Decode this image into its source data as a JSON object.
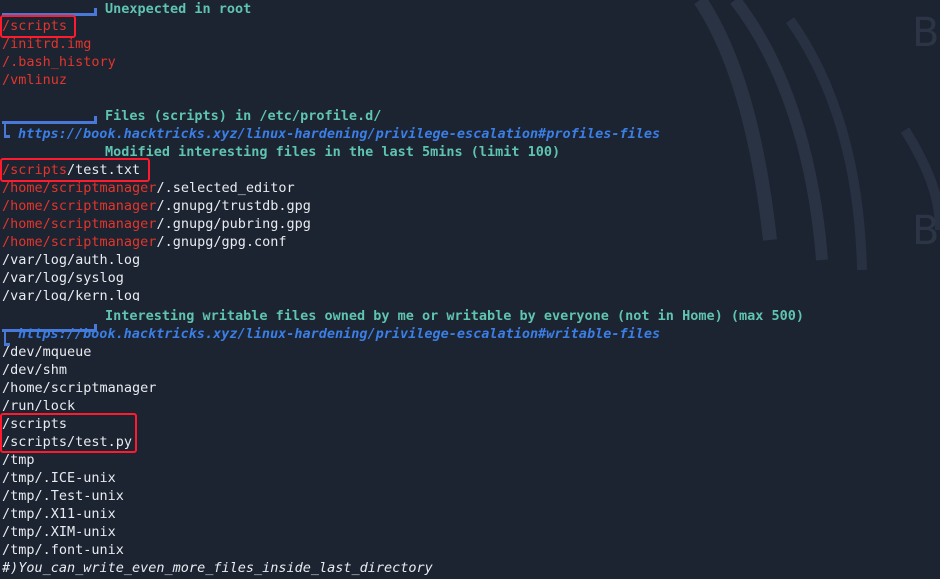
{
  "watermark": {
    "letter": "B"
  },
  "sections": {
    "unexpected_in_root": {
      "title": "Unexpected in root",
      "items": [
        "/scripts",
        "/initrd.img",
        "/.bash_history",
        "/vmlinuz"
      ]
    },
    "profile_files": {
      "title": "Files (scripts) in /etc/profile.d/",
      "link": "https://book.hacktricks.xyz/linux-hardening/privilege-escalation#profiles-files"
    },
    "modified_files": {
      "title": "Modified interesting files in the last 5mins (limit 100)",
      "items": [
        {
          "red": "/scripts",
          "white": "/test.txt"
        },
        {
          "red": "/home/scriptmanager",
          "white": "/.selected_editor"
        },
        {
          "red": "/home/scriptmanager",
          "white": "/.gnupg/trustdb.gpg"
        },
        {
          "red": "/home/scriptmanager",
          "white": "/.gnupg/pubring.gpg"
        },
        {
          "red": "/home/scriptmanager",
          "white": "/.gnupg/gpg.conf"
        },
        {
          "red": "",
          "white": "/var/log/auth.log"
        },
        {
          "red": "",
          "white": "/var/log/syslog"
        },
        {
          "red": "",
          "white": "/var/log/kern.log"
        }
      ]
    },
    "writable_files": {
      "title": "Interesting writable files owned by me or writable by everyone (not in Home) (max 500)",
      "link": "https://book.hacktricks.xyz/linux-hardening/privilege-escalation#writable-files",
      "items": [
        "/dev/mqueue",
        "/dev/shm",
        "/home/scriptmanager",
        "/run/lock",
        "/scripts",
        "/scripts/test.py",
        "/tmp",
        "/tmp/.ICE-unix",
        "/tmp/.Test-unix",
        "/tmp/.X11-unix",
        "/tmp/.XIM-unix",
        "/tmp/.font-unix"
      ],
      "footer": "#)You_can_write_even_more_files_inside_last_directory"
    }
  },
  "colors": {
    "background": "#1c2331",
    "red": "#e2362c",
    "header": "#5fc4b0",
    "link": "#3b7fe6",
    "highlight": "#ff1a2e",
    "frame": "#4a78d6"
  }
}
